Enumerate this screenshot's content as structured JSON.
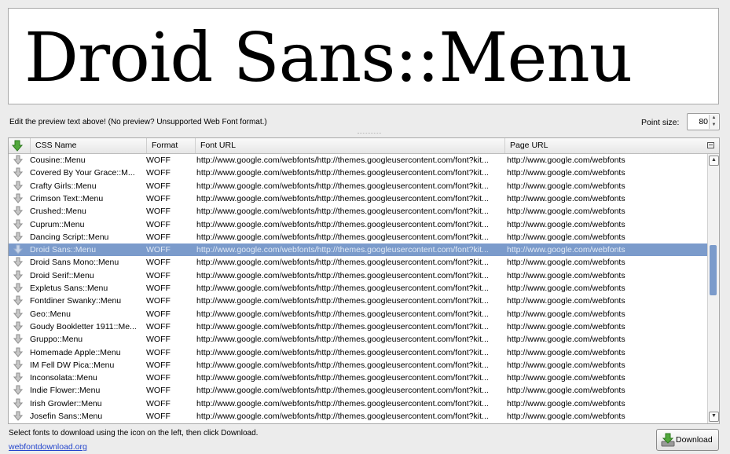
{
  "preview": {
    "text": "Droid Sans::Menu"
  },
  "hint": "Edit the preview text above! (No preview? Unsupported Web Font format.)",
  "point_size": {
    "label": "Point size:",
    "value": "80"
  },
  "table": {
    "columns": [
      "CSS Name",
      "Format",
      "Font URL",
      "Page URL"
    ],
    "rows": [
      {
        "name": "Cousine::Menu",
        "format": "WOFF",
        "font_url": "http://www.google.com/webfonts/http://themes.googleusercontent.com/font?kit...",
        "page_url": "http://www.google.com/webfonts"
      },
      {
        "name": "Covered By Your Grace::M...",
        "format": "WOFF",
        "font_url": "http://www.google.com/webfonts/http://themes.googleusercontent.com/font?kit...",
        "page_url": "http://www.google.com/webfonts"
      },
      {
        "name": "Crafty Girls::Menu",
        "format": "WOFF",
        "font_url": "http://www.google.com/webfonts/http://themes.googleusercontent.com/font?kit...",
        "page_url": "http://www.google.com/webfonts"
      },
      {
        "name": "Crimson Text::Menu",
        "format": "WOFF",
        "font_url": "http://www.google.com/webfonts/http://themes.googleusercontent.com/font?kit...",
        "page_url": "http://www.google.com/webfonts"
      },
      {
        "name": "Crushed::Menu",
        "format": "WOFF",
        "font_url": "http://www.google.com/webfonts/http://themes.googleusercontent.com/font?kit...",
        "page_url": "http://www.google.com/webfonts"
      },
      {
        "name": "Cuprum::Menu",
        "format": "WOFF",
        "font_url": "http://www.google.com/webfonts/http://themes.googleusercontent.com/font?kit...",
        "page_url": "http://www.google.com/webfonts"
      },
      {
        "name": "Dancing Script::Menu",
        "format": "WOFF",
        "font_url": "http://www.google.com/webfonts/http://themes.googleusercontent.com/font?kit...",
        "page_url": "http://www.google.com/webfonts"
      },
      {
        "name": "Droid Sans::Menu",
        "format": "WOFF",
        "font_url": "http://www.google.com/webfonts/http://themes.googleusercontent.com/font?kit...",
        "page_url": "http://www.google.com/webfonts",
        "selected": true
      },
      {
        "name": "Droid Sans Mono::Menu",
        "format": "WOFF",
        "font_url": "http://www.google.com/webfonts/http://themes.googleusercontent.com/font?kit...",
        "page_url": "http://www.google.com/webfonts"
      },
      {
        "name": "Droid Serif::Menu",
        "format": "WOFF",
        "font_url": "http://www.google.com/webfonts/http://themes.googleusercontent.com/font?kit...",
        "page_url": "http://www.google.com/webfonts"
      },
      {
        "name": "Expletus Sans::Menu",
        "format": "WOFF",
        "font_url": "http://www.google.com/webfonts/http://themes.googleusercontent.com/font?kit...",
        "page_url": "http://www.google.com/webfonts"
      },
      {
        "name": "Fontdiner Swanky::Menu",
        "format": "WOFF",
        "font_url": "http://www.google.com/webfonts/http://themes.googleusercontent.com/font?kit...",
        "page_url": "http://www.google.com/webfonts"
      },
      {
        "name": "Geo::Menu",
        "format": "WOFF",
        "font_url": "http://www.google.com/webfonts/http://themes.googleusercontent.com/font?kit...",
        "page_url": "http://www.google.com/webfonts"
      },
      {
        "name": "Goudy Bookletter 1911::Me...",
        "format": "WOFF",
        "font_url": "http://www.google.com/webfonts/http://themes.googleusercontent.com/font?kit...",
        "page_url": "http://www.google.com/webfonts"
      },
      {
        "name": "Gruppo::Menu",
        "format": "WOFF",
        "font_url": "http://www.google.com/webfonts/http://themes.googleusercontent.com/font?kit...",
        "page_url": "http://www.google.com/webfonts"
      },
      {
        "name": "Homemade Apple::Menu",
        "format": "WOFF",
        "font_url": "http://www.google.com/webfonts/http://themes.googleusercontent.com/font?kit...",
        "page_url": "http://www.google.com/webfonts"
      },
      {
        "name": "IM Fell DW Pica::Menu",
        "format": "WOFF",
        "font_url": "http://www.google.com/webfonts/http://themes.googleusercontent.com/font?kit...",
        "page_url": "http://www.google.com/webfonts"
      },
      {
        "name": "Inconsolata::Menu",
        "format": "WOFF",
        "font_url": "http://www.google.com/webfonts/http://themes.googleusercontent.com/font?kit...",
        "page_url": "http://www.google.com/webfonts"
      },
      {
        "name": "Indie Flower::Menu",
        "format": "WOFF",
        "font_url": "http://www.google.com/webfonts/http://themes.googleusercontent.com/font?kit...",
        "page_url": "http://www.google.com/webfonts"
      },
      {
        "name": "Irish Growler::Menu",
        "format": "WOFF",
        "font_url": "http://www.google.com/webfonts/http://themes.googleusercontent.com/font?kit...",
        "page_url": "http://www.google.com/webfonts"
      },
      {
        "name": "Josefin Sans::Menu",
        "format": "WOFF",
        "font_url": "http://www.google.com/webfonts/http://themes.googleusercontent.com/font?kit...",
        "page_url": "http://www.google.com/webfonts"
      }
    ]
  },
  "footer": {
    "instructions": "Select fonts to download using the icon on the left, then click Download.",
    "link": "webfontdownload.org"
  },
  "download_button": {
    "label": "Download"
  },
  "icons": {
    "row_download": "download-arrow-icon",
    "header_download": "download-arrow-icon",
    "column_menu": "column-menu-icon"
  },
  "colors": {
    "selection": "#7b9bcb",
    "link": "#2244cc"
  }
}
